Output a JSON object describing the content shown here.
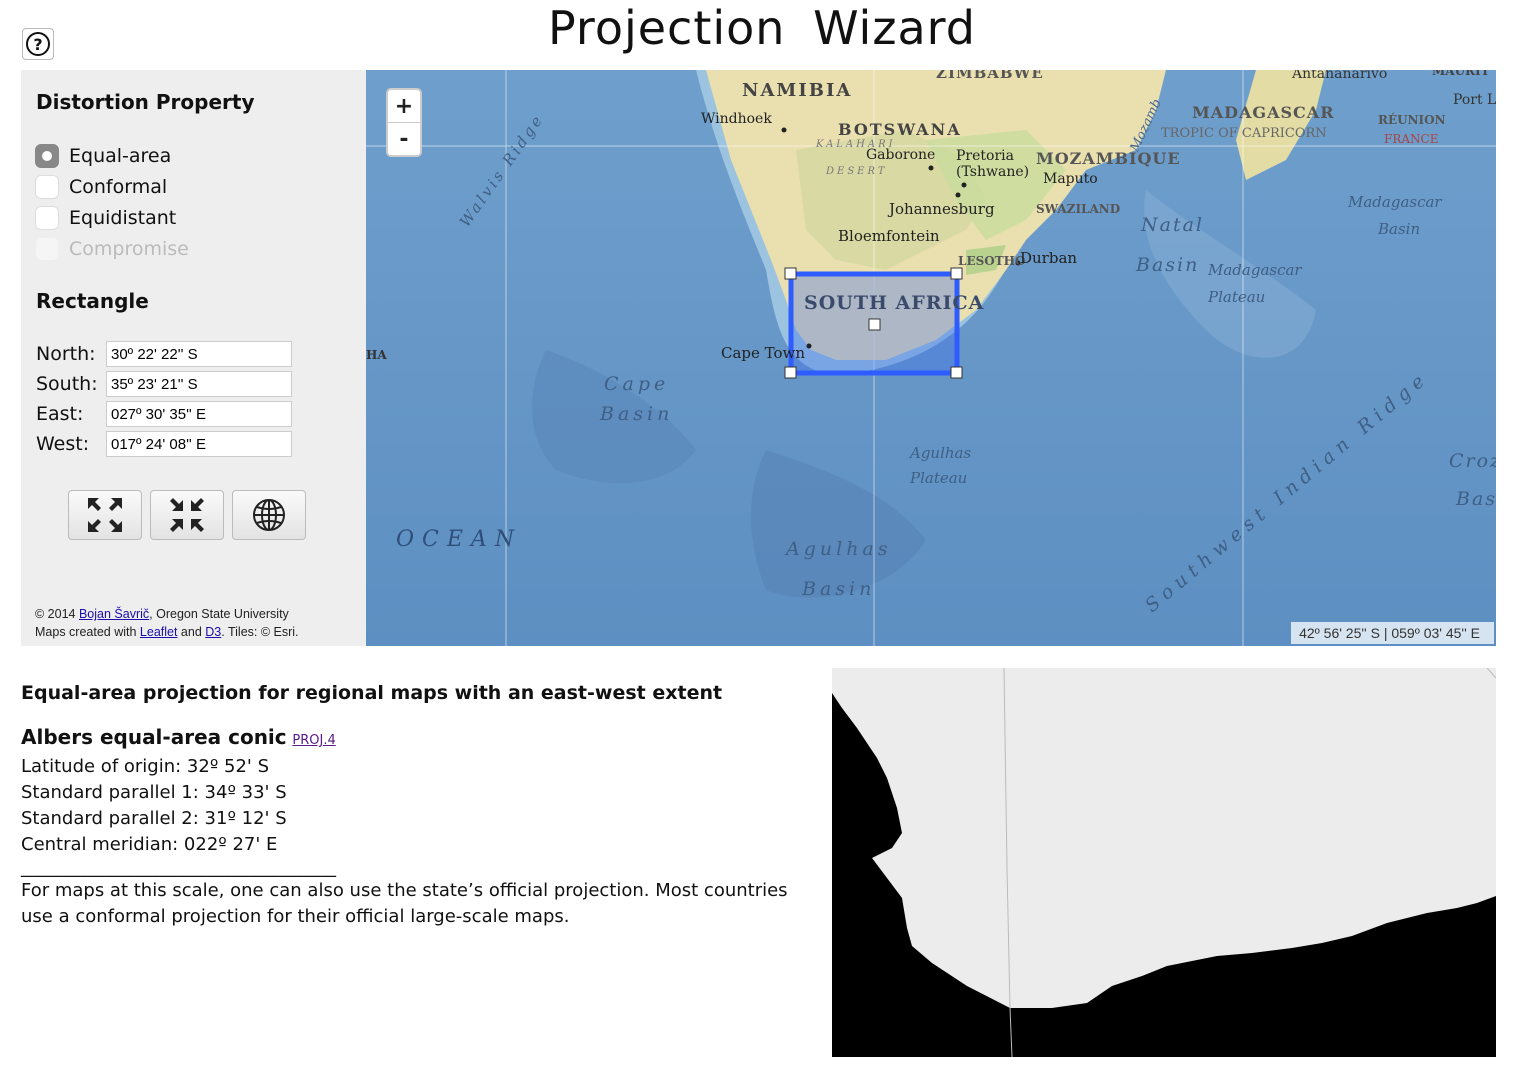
{
  "title": "Projection  Wizard",
  "help": {
    "icon": "question-mark-icon",
    "label": "?"
  },
  "distortion": {
    "heading": "Distortion Property",
    "options": [
      {
        "label": "Equal-area",
        "checked": true,
        "disabled": false
      },
      {
        "label": "Conformal",
        "checked": false,
        "disabled": false
      },
      {
        "label": "Equidistant",
        "checked": false,
        "disabled": false
      },
      {
        "label": "Compromise",
        "checked": false,
        "disabled": true
      }
    ]
  },
  "rectangle": {
    "heading": "Rectangle",
    "north": {
      "label": "North:",
      "value": "30º 22' 22'' S"
    },
    "south": {
      "label": "South:",
      "value": "35º 23' 21'' S"
    },
    "east": {
      "label": "East:",
      "value": "027º 30' 35'' E"
    },
    "west": {
      "label": "West:",
      "value": "017º 24' 08'' E"
    }
  },
  "tools": [
    {
      "name": "expand-extent-button",
      "icon": "expand-arrows-icon"
    },
    {
      "name": "shrink-extent-button",
      "icon": "compress-arrows-icon"
    },
    {
      "name": "world-extent-button",
      "icon": "globe-icon"
    }
  ],
  "credits": {
    "line1_prefix": "© 2014 ",
    "author": "Bojan Šavrič",
    "line1_suffix": ", Oregon State University",
    "line2_prefix": "Maps created with ",
    "leaflet": "Leaflet",
    "and": " and ",
    "d3": "D3",
    "line2_suffix": ". Tiles: © Esri."
  },
  "map": {
    "zoom_in": "+",
    "zoom_out": "-",
    "cursor_readout": "42º 56' 25'' S | 059º 03' 45'' E",
    "labels": {
      "zimbabwe": "ZIMBABWE",
      "antananarivo": "Antananarivo",
      "mauritius": "MAURIT",
      "port_louis": "Port L",
      "namibia": "NAMIBIA",
      "windhoek": "Windhoek",
      "botswana": "BOTSWANA",
      "kalahari": "KALAHARI",
      "desert": "DESERT",
      "gaborone": "Gaborone",
      "pretoria": "Pretoria",
      "tshwane": "(Tshwane)",
      "mozambique": "MOZAMBIQUE",
      "maputo": "Maputo",
      "madagascar": "MADAGASCAR",
      "tropic": "TROPIC OF CAPRICORN",
      "reunion": "RÉUNION",
      "france": "FRANCE",
      "mozambique_channel": "Mozamb",
      "johannesburg": "Johannesburg",
      "swaziland": "SWAZILAND",
      "natal": "Natal",
      "natal_basin": "Basin",
      "madagascar_basin_1": "Madagascar",
      "madagascar_basin_2": "Basin",
      "bloemfontein": "Bloemfontein",
      "lesotho": "LESOTHO",
      "durban": "Durban",
      "madagascar_plateau_1": "Madagascar",
      "madagascar_plateau_2": "Plateau",
      "walvis": "Walvis Ridge",
      "south_africa": "SOUTH AFRICA",
      "cape_town": "Cape Town",
      "ha": "HA",
      "cape_basin_1": "Cape",
      "cape_basin_2": "Basin",
      "agulhas_plateau_1": "Agulhas",
      "agulhas_plateau_2": "Plateau",
      "ocean": "OCEAN",
      "agulhas_basin_1": "Agulhas",
      "agulhas_basin_2": "Basin",
      "sw_indian_ridge": "Southwest Indian Ridge",
      "croz": "Croz",
      "basi": "Basi"
    }
  },
  "result": {
    "heading": "Equal-area projection for regional maps with an east-west extent",
    "projection_name": "Albers equal-area conic",
    "proj4_link": "PROJ.4",
    "lat_origin": "Latitude of origin: 32º 52' S",
    "std_parallel_1": "Standard parallel 1: 34º 33' S",
    "std_parallel_2": "Standard parallel 2: 31º 12' S",
    "central_meridian": "Central meridian: 022º 27' E",
    "divider": "___________________________________",
    "note": "For maps at this scale, one can also use the state’s official projection. Most countries use a conformal projection for their official large-scale maps."
  }
}
